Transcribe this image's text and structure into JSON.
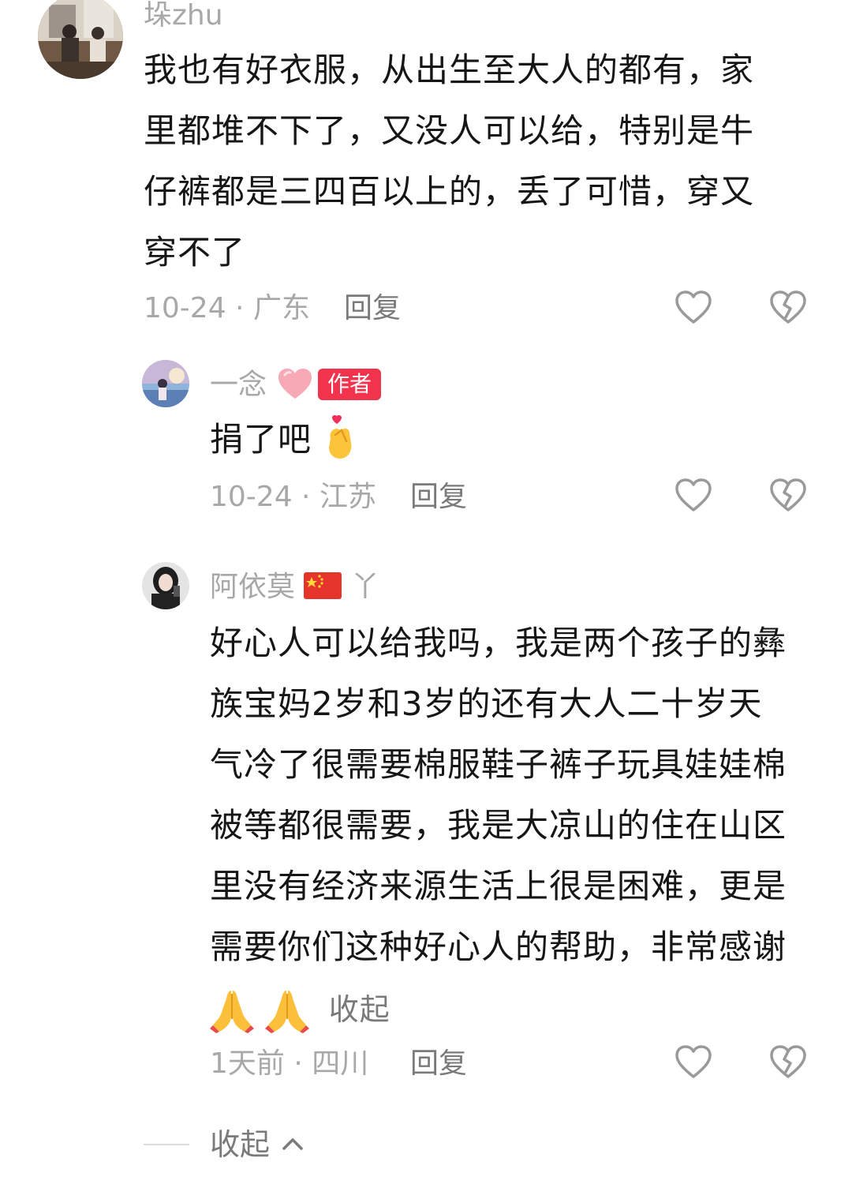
{
  "comments": [
    {
      "username": "垛zhu",
      "avatar_icon": "avatar-photo-icon",
      "text_lines": [
        "我也有好衣服，从出生至大人的都有，家",
        "里都堆不下了，又没人可以给，特别是牛",
        "仔裤都是三四百以上的，丢了可惜，穿又",
        "穿不了"
      ],
      "meta": "10-24 · 广东",
      "reply_label": "回复"
    },
    {
      "username": "一念",
      "badge": "作者",
      "avatar_icon": "avatar-photo-icon",
      "text": "捐了吧",
      "meta": "10-24 · 江苏",
      "reply_label": "回复"
    },
    {
      "username": "阿依莫",
      "username_suffix": "丫",
      "avatar_icon": "avatar-photo-icon",
      "text_lines": [
        "好心人可以给我吗，我是两个孩子的彝",
        "族宝妈2岁和3岁的还有大人二十岁天",
        "气冷了很需要棉服鞋子裤子玩具娃娃棉",
        "被等都很需要，我是大凉山的住在山区",
        "里没有经济来源生活上很是困难，更是",
        "需要你们这种好心人的帮助，非常感谢"
      ],
      "collapse_label": "收起",
      "meta": "1天前 · 四川",
      "reply_label": "回复"
    }
  ],
  "footer": {
    "collapse_label": "收起"
  },
  "colors": {
    "badge": "#f2334e",
    "muted_text": "#a8a8a8",
    "reply_text": "#7a7a7a",
    "body_text": "#161616",
    "icon_stroke": "#9a9a9a"
  },
  "icons": {
    "like": "heart-outline-icon",
    "dislike": "broken-heart-icon",
    "emoji_heart": "pink-heart-emoji-icon",
    "emoji_finger_heart": "finger-heart-emoji-icon",
    "emoji_flag": "china-flag-emoji-icon",
    "emoji_pray": "folded-hands-emoji-icon",
    "chevron": "chevron-up-icon"
  }
}
